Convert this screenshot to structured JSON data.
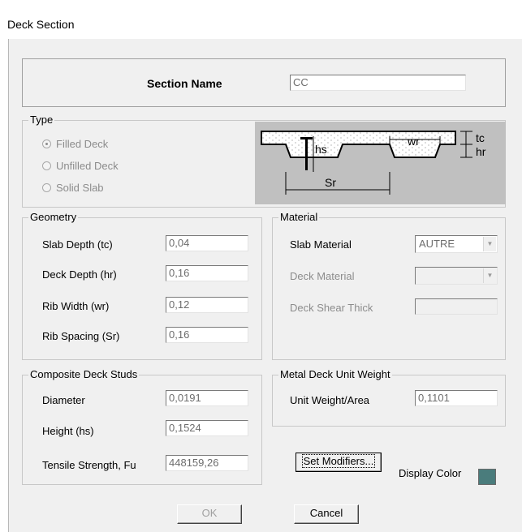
{
  "window": {
    "title": "Deck Section"
  },
  "section_name": {
    "label": "Section Name",
    "value": "CC"
  },
  "type_group": {
    "legend": "Type",
    "options": [
      {
        "label": "Filled Deck",
        "selected": true
      },
      {
        "label": "Unfilled Deck",
        "selected": false
      },
      {
        "label": "Solid Slab",
        "selected": false
      }
    ],
    "diagram_labels": {
      "hs": "hs",
      "wr": "wr",
      "sr": "Sr",
      "tc": "tc",
      "hr": "hr"
    }
  },
  "geometry": {
    "legend": "Geometry",
    "fields": [
      {
        "label": "Slab Depth (tc)",
        "value": "0,04"
      },
      {
        "label": "Deck Depth (hr)",
        "value": "0,16"
      },
      {
        "label": "Rib Width (wr)",
        "value": "0,12"
      },
      {
        "label": "Rib Spacing (Sr)",
        "value": "0,16"
      }
    ]
  },
  "material": {
    "legend": "Material",
    "slab_material": {
      "label": "Slab Material",
      "value": "AUTRE"
    },
    "deck_material": {
      "label": "Deck Material",
      "value": ""
    },
    "deck_shear_thick": {
      "label": "Deck Shear Thick",
      "value": ""
    }
  },
  "studs": {
    "legend": "Composite Deck Studs",
    "fields": [
      {
        "label": "Diameter",
        "value": "0,0191"
      },
      {
        "label": "Height (hs)",
        "value": "0,1524"
      },
      {
        "label": "Tensile Strength, Fu",
        "value": "448159,26"
      }
    ]
  },
  "unit_weight": {
    "legend": "Metal Deck Unit Weight",
    "label": "Unit Weight/Area",
    "value": "0,1101"
  },
  "modifiers": {
    "label": "Set Modifiers..."
  },
  "display_color": {
    "label": "Display Color",
    "color": "#4a7c7c"
  },
  "buttons": {
    "ok": "OK",
    "cancel": "Cancel"
  },
  "colors": {
    "dialog_bg": "#f0f0f0",
    "diagram_bg": "#c0c0c0"
  }
}
